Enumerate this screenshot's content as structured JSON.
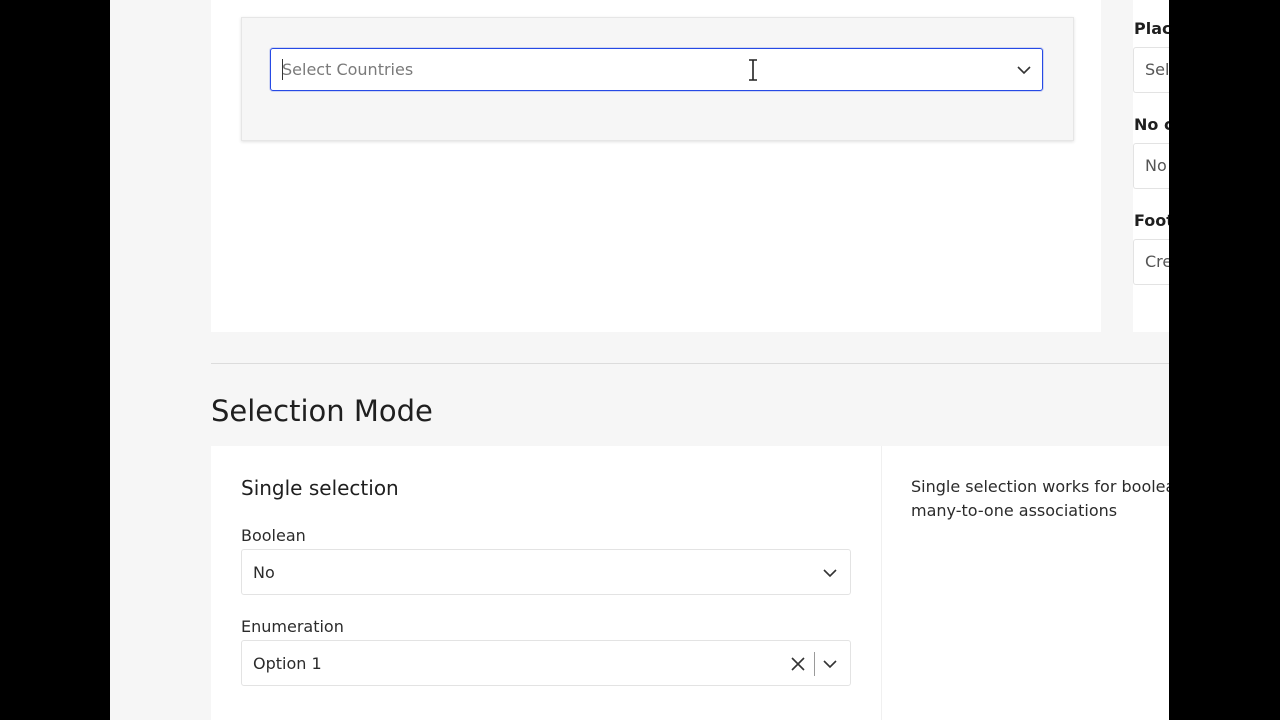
{
  "top_demo": {
    "select_placeholder": "Select Countries"
  },
  "side_settings": [
    {
      "label": "Place",
      "value": "Sel"
    },
    {
      "label": "No c",
      "value": "No"
    },
    {
      "label": "Foot",
      "value": "Cre"
    }
  ],
  "section": {
    "title": "Selection Mode"
  },
  "single_selection": {
    "title": "Single selection",
    "boolean_label": "Boolean",
    "boolean_value": "No",
    "enumeration_label": "Enumeration",
    "enumeration_value": "Option 1"
  },
  "description": {
    "line1": "Single selection works for boolea",
    "line2": "many-to-one associations"
  },
  "colors": {
    "focus_border": "#264ae5",
    "panel": "#ffffff",
    "background": "#f6f6f6"
  },
  "icons": [
    "chevron-down-icon",
    "clear-icon",
    "text-cursor-icon"
  ]
}
